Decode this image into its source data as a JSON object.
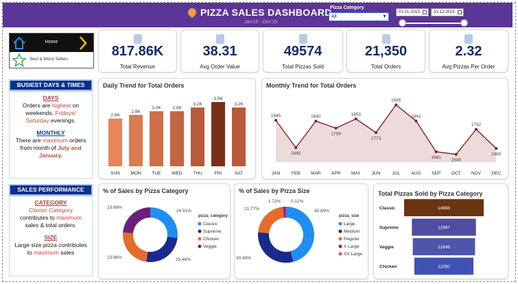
{
  "header": {
    "title": "PIZZA SALES DASHBOARD",
    "subtitle": "Jan'15 - Dec'15",
    "filter_label": "Pizza Category",
    "filter_value": "All",
    "date_from": "01-01-2015",
    "date_to": "31-12-2015"
  },
  "nav": {
    "home_label": "Home",
    "best_worst_label": "Best & Worst Sellers"
  },
  "kpis": [
    {
      "value": "817.86K",
      "label": "Total Revenue",
      "icon": "money-bag-icon"
    },
    {
      "value": "38.31",
      "label": "Avg Order Value",
      "icon": "receipt-icon"
    },
    {
      "value": "49574",
      "label": "Total Pizzas Sold",
      "icon": "pizza-icon"
    },
    {
      "value": "21,350",
      "label": "Total Orders",
      "icon": "clipboard-icon"
    },
    {
      "value": "2.32",
      "label": "Avg Pizzas Per Order",
      "icon": "bar-chart-icon"
    }
  ],
  "sidebar": {
    "busiest": {
      "title": "BUSIEST DAYS & TIMES",
      "days_head": "DAYS",
      "days_1": "Orders are ",
      "days_2": "highest",
      "days_3": " on weekends, ",
      "days_4": "Fridays/ Saturday",
      "days_5": " evenings.",
      "monthly_head": "MONTHLY",
      "monthly_1": "There are ",
      "monthly_2": "maximum",
      "monthly_3": " orders from month of ",
      "monthly_4": "July and January."
    },
    "sales": {
      "title": "SALES PERFORMANCE",
      "cat_head": "CATEGORY",
      "cat_1": "Classic Category",
      "cat_2": " contributes to ",
      "cat_3": "maximum",
      "cat_4": " sales & total orders.",
      "size_head": "SIZE",
      "size_1": "Large size pizza contributes to ",
      "size_2": "maximum",
      "size_3": " sales"
    }
  },
  "chart_data": [
    {
      "type": "bar",
      "title": "Daily Trend for Total Orders",
      "categories": [
        "SUN",
        "MON",
        "TUE",
        "WED",
        "THU",
        "FRI",
        "SAT"
      ],
      "values": [
        2.6,
        2.8,
        3.0,
        3.0,
        3.2,
        3.5,
        3.2
      ],
      "value_labels": [
        "2.6K",
        "2.8K",
        "3.0K",
        "3.0K",
        "3.2K",
        "3.5K",
        "3.2K"
      ],
      "unit": "K",
      "ylim": [
        0,
        3.8
      ],
      "colors": [
        "#e6865b",
        "#dc7a51",
        "#cf6e48",
        "#c56442",
        "#b95a3b",
        "#7a2f18",
        "#b95a3b"
      ]
    },
    {
      "type": "area",
      "title": "Monthly Trend for Total Orders",
      "categories": [
        "JAN",
        "FEB",
        "MAR",
        "APR",
        "MAY",
        "JUN",
        "JUL",
        "AUG",
        "SEP",
        "OCT",
        "NOV",
        "DEC"
      ],
      "values": [
        1845,
        1685,
        1840,
        1799,
        1853,
        1773,
        1935,
        1841,
        1661,
        1646,
        1792,
        1680
      ],
      "ylim": [
        1600,
        1960
      ],
      "color": "#7a1f28",
      "fill": "#eddbdb"
    },
    {
      "type": "pie",
      "title": "% of Sales by Pizza Category",
      "legend_title": "pizza_category",
      "labels": [
        "Classic",
        "Supreme",
        "Chicken",
        "Veggie"
      ],
      "values": [
        26.91,
        25.46,
        23.96,
        23.68
      ],
      "value_labels": [
        "26.91%",
        "25.46%",
        "23.96%",
        "23.68%"
      ],
      "colors": [
        "#1f8ef0",
        "#1a2a8c",
        "#e56c2c",
        "#6b1f7a"
      ]
    },
    {
      "type": "pie",
      "title": "% of Sales by Pizza Size",
      "legend_title": "pizza_size",
      "labels": [
        "Large",
        "Medium",
        "Regular",
        "X Large",
        "XX Large"
      ],
      "values": [
        45.89,
        30.49,
        21.77,
        1.72,
        0.12
      ],
      "value_labels": [
        "45.89%",
        "30.49%",
        "21.77%",
        "1.72%",
        "0.12%"
      ],
      "colors": [
        "#1f8ef0",
        "#1a2a8c",
        "#e56c2c",
        "#8a1f8a",
        "#e0458a"
      ]
    },
    {
      "type": "bar",
      "title": "Total Pizzas Sold by Pizza Category",
      "categories": [
        "Classic",
        "Supreme",
        "Veggie",
        "Chicken"
      ],
      "values": [
        14888,
        11987,
        11649,
        11050
      ],
      "colors": [
        "#6b3410",
        "#4f4da0",
        "#4f55ab",
        "#3f51b5"
      ],
      "xlim": [
        0,
        14888
      ]
    }
  ]
}
